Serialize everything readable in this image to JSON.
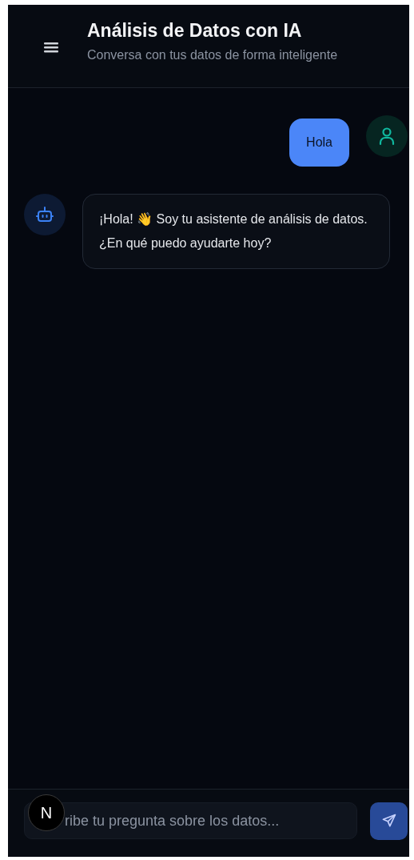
{
  "header": {
    "title": "Análisis de Datos con IA",
    "subtitle": "Conversa con tus datos de forma inteligente"
  },
  "messages": [
    {
      "kind": "user",
      "text": "Hola"
    },
    {
      "kind": "assistant",
      "text": "¡Hola! 👋 Soy tu asistente de análisis de datos. ¿En qué puedo ayudarte hoy?"
    }
  ],
  "composer": {
    "placeholder": "ribe tu pregunta sobre los datos..."
  },
  "dev_badge": {
    "letter": "N"
  }
}
